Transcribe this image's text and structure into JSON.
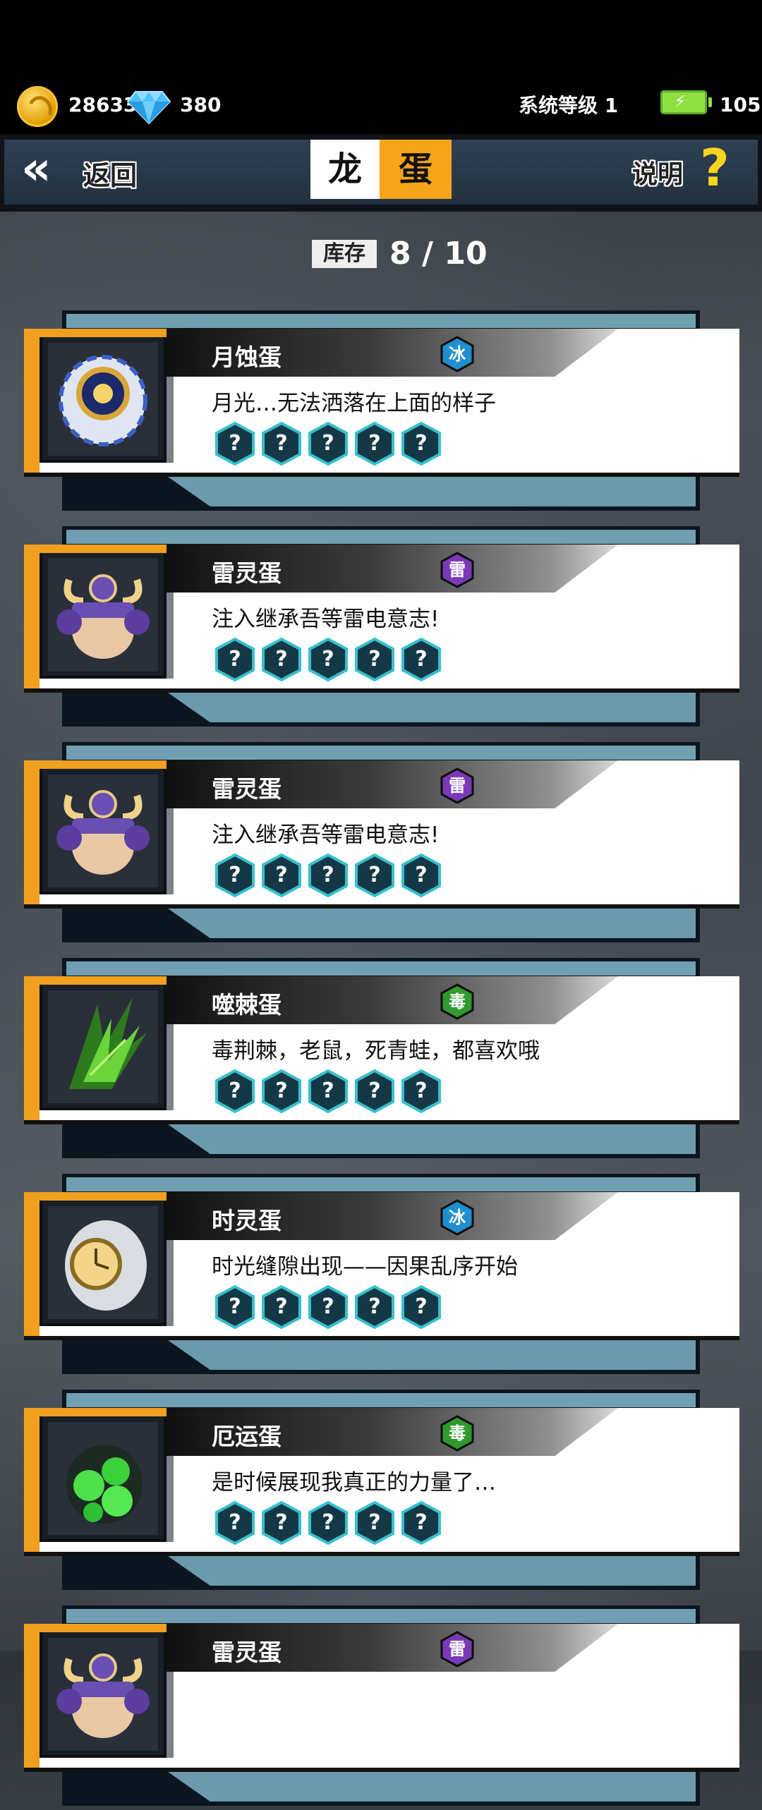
{
  "currency": {
    "coins": "28633",
    "diamonds": "380",
    "system_level": "系统等级 1",
    "energy": "105",
    "colors": {
      "coin": "#f6c23a",
      "diamond": "#4fc3ff",
      "battery": "#8ee040"
    }
  },
  "header": {
    "back_label": "返回",
    "title_left": "龙",
    "title_right": "蛋",
    "help_label": "说明",
    "help_icon": "?"
  },
  "inventory": {
    "label": "库存",
    "value": "8 / 10"
  },
  "eggs": [
    {
      "name": "月蚀蛋",
      "element": "冰",
      "element_color": "#1e8fd0",
      "desc": "月光…无法洒落在上面的样子",
      "slots": [
        "?",
        "?",
        "?",
        "?",
        "?"
      ],
      "icon": "lunar-egg-icon"
    },
    {
      "name": "雷灵蛋",
      "element": "雷",
      "element_color": "#7a3ab8",
      "desc": "注入继承吾等雷电意志!",
      "slots": [
        "?",
        "?",
        "?",
        "?",
        "?"
      ],
      "icon": "thunder-egg-icon"
    },
    {
      "name": "雷灵蛋",
      "element": "雷",
      "element_color": "#7a3ab8",
      "desc": "注入继承吾等雷电意志!",
      "slots": [
        "?",
        "?",
        "?",
        "?",
        "?"
      ],
      "icon": "thunder-egg-icon"
    },
    {
      "name": "噬棘蛋",
      "element": "毒",
      "element_color": "#2f9a2f",
      "desc": "毒荆棘，老鼠，死青蛙，都喜欢哦",
      "slots": [
        "?",
        "?",
        "?",
        "?",
        "?"
      ],
      "icon": "thorn-egg-icon"
    },
    {
      "name": "时灵蛋",
      "element": "冰",
      "element_color": "#1e8fd0",
      "desc": "时光缝隙出现——因果乱序开始",
      "slots": [
        "?",
        "?",
        "?",
        "?",
        "?"
      ],
      "icon": "time-egg-icon"
    },
    {
      "name": "厄运蛋",
      "element": "毒",
      "element_color": "#2f9a2f",
      "desc": "是时候展现我真正的力量了…",
      "slots": [
        "?",
        "?",
        "?",
        "?",
        "?"
      ],
      "icon": "doom-egg-icon"
    },
    {
      "name": "雷灵蛋",
      "element": "雷",
      "element_color": "#7a3ab8",
      "desc": "",
      "slots": [],
      "icon": "thunder-egg-icon"
    }
  ]
}
